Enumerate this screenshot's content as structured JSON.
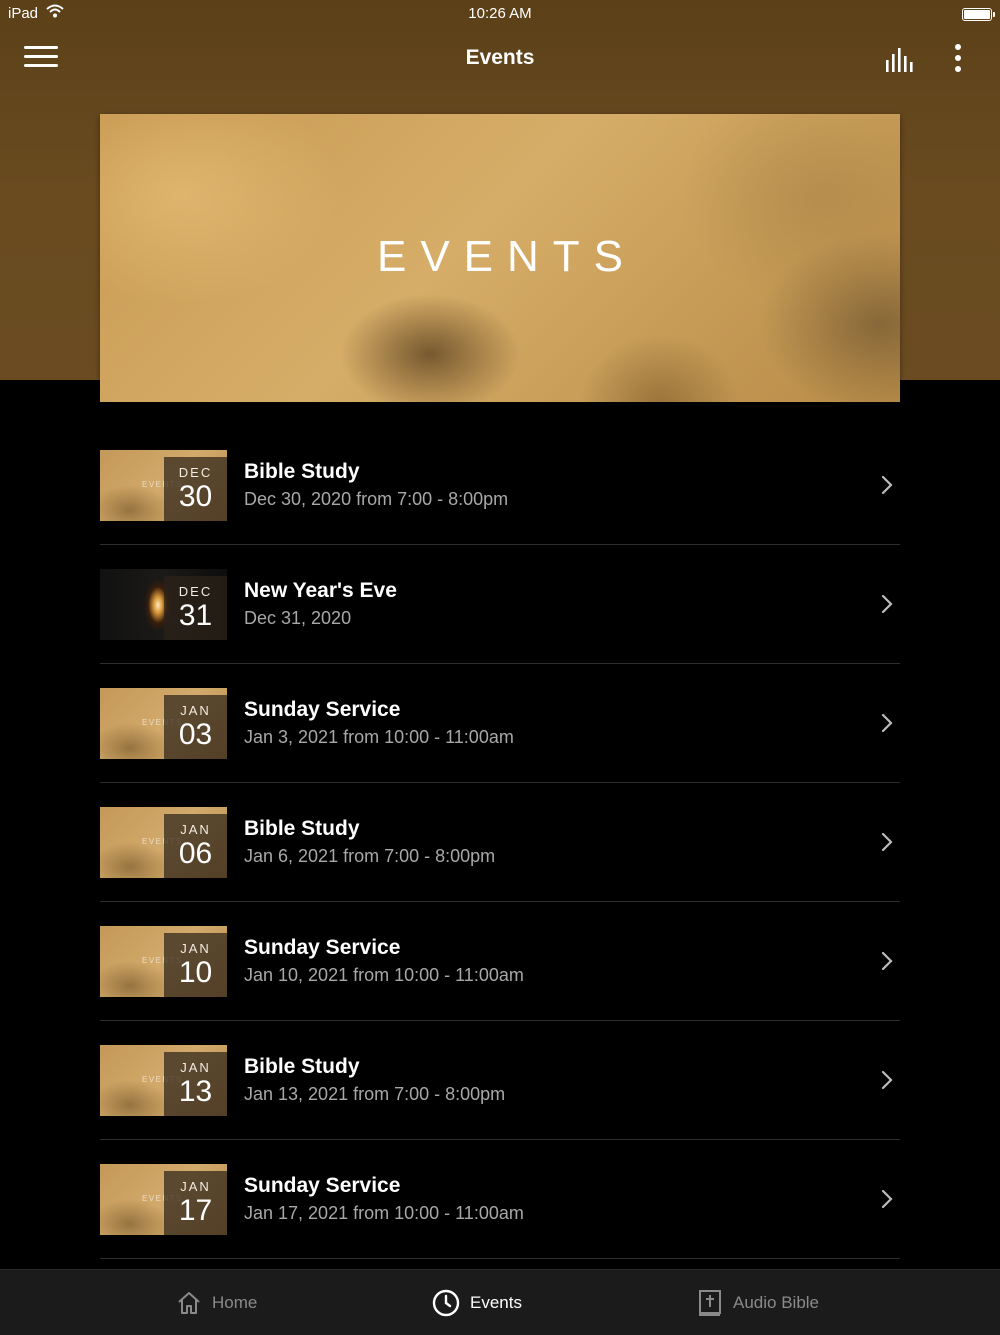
{
  "status_bar": {
    "device": "iPad",
    "time": "10:26 AM"
  },
  "nav": {
    "title": "Events"
  },
  "hero": {
    "text": "EVENTS"
  },
  "thumb_watermark": "EVENTS",
  "events": [
    {
      "month": "DEC",
      "day": "30",
      "title": "Bible Study",
      "subtitle": "Dec 30, 2020 from 7:00 - 8:00pm",
      "thumb": "events"
    },
    {
      "month": "DEC",
      "day": "31",
      "title": "New Year's Eve",
      "subtitle": "Dec 31, 2020",
      "thumb": "candle"
    },
    {
      "month": "JAN",
      "day": "03",
      "title": "Sunday Service",
      "subtitle": "Jan 3, 2021 from 10:00 - 11:00am",
      "thumb": "events"
    },
    {
      "month": "JAN",
      "day": "06",
      "title": "Bible Study",
      "subtitle": "Jan 6, 2021 from 7:00 - 8:00pm",
      "thumb": "events"
    },
    {
      "month": "JAN",
      "day": "10",
      "title": "Sunday Service",
      "subtitle": "Jan 10, 2021 from 10:00 - 11:00am",
      "thumb": "events"
    },
    {
      "month": "JAN",
      "day": "13",
      "title": "Bible Study",
      "subtitle": "Jan 13, 2021 from 7:00 - 8:00pm",
      "thumb": "events"
    },
    {
      "month": "JAN",
      "day": "17",
      "title": "Sunday Service",
      "subtitle": "Jan 17, 2021 from 10:00 - 11:00am",
      "thumb": "events"
    }
  ],
  "tabs": [
    {
      "label": "Home",
      "icon": "home-icon",
      "active": false
    },
    {
      "label": "Events",
      "icon": "clock-icon",
      "active": true
    },
    {
      "label": "Audio Bible",
      "icon": "bible-icon",
      "active": false
    }
  ],
  "colors": {
    "header_brown": "#6a4b20",
    "hero_gold": "#d2aa6b",
    "background": "#000000",
    "tab_bar": "#1b1b1b"
  }
}
